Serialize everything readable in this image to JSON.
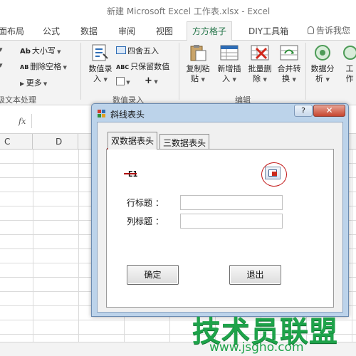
{
  "window": {
    "title": "新建 Microsoft Excel 工作表.xlsx - Excel"
  },
  "ribbon_tabs": [
    {
      "label": "面布局"
    },
    {
      "label": "公式"
    },
    {
      "label": "数据"
    },
    {
      "label": "审阅"
    },
    {
      "label": "视图"
    },
    {
      "label": "方方格子",
      "active": true
    },
    {
      "label": "DIY工具箱"
    }
  ],
  "tell_me": {
    "label": "告诉我您"
  },
  "ribbon": {
    "text_group": {
      "case_btn": {
        "icon": "Ab",
        "label": "大小写"
      },
      "del_space_btn": {
        "icon": "AB",
        "label": "删除空格"
      },
      "more_btn": {
        "label": "更多"
      },
      "label": "级文本处理"
    },
    "numeric_group": {
      "numeric_entry": {
        "label_line1": "数值录",
        "label_line2": "入"
      },
      "round_btn": {
        "label": "四舍五入"
      },
      "keep_value_btn": {
        "icon": "ABC",
        "label": "只保留数值"
      },
      "plus_btn": {
        "label": "+"
      },
      "label": "数值录入"
    },
    "edit_group": {
      "copy_paste": {
        "label_line1": "复制粘",
        "label_line2": "贴"
      },
      "insert": {
        "label_line1": "新增插",
        "label_line2": "入"
      },
      "batch_delete": {
        "label_line1": "批量删",
        "label_line2": "除"
      },
      "merge_convert": {
        "label_line1": "合并转",
        "label_line2": "换"
      },
      "label": "编辑"
    },
    "analysis": {
      "label_line1": "数据分",
      "label_line2": "析"
    },
    "work": {
      "label_line1": "工",
      "label_line2": "作"
    }
  },
  "formula_bar": {
    "fx": "fx"
  },
  "columns": [
    "C",
    "D"
  ],
  "dialog": {
    "title": "斜线表头",
    "help_label": "?",
    "close_label": "✕",
    "tabs": [
      {
        "label": "双数据表头",
        "active": true
      },
      {
        "label": "三数据表头"
      }
    ],
    "cell_ref": "E1",
    "row_title_label": "行标题 ：",
    "col_title_label": "列标题 ：",
    "row_title_value": "",
    "col_title_value": "",
    "ok_label": "确定",
    "exit_label": "退出"
  },
  "watermark": {
    "text": "技术员联盟",
    "url": "www.jsgho.com"
  },
  "colors": {
    "excel_green": "#217346",
    "annotation_red": "#c21919",
    "watermark_green": "#1ea34a"
  }
}
